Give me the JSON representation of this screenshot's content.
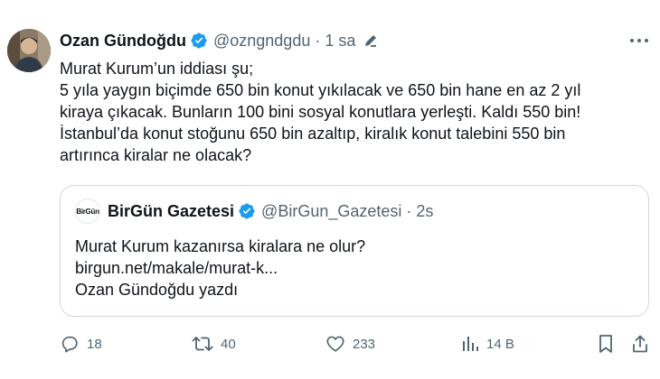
{
  "tweet": {
    "author_name": "Ozan Gündoğdu",
    "handle": "@ozngndgdu",
    "separator": "·",
    "time": "1 sa",
    "lines": [
      "Murat Kurum’un iddiası şu;",
      "5 yıla yaygın biçimde 650 bin konut yıkılacak ve 650 bin hane en az 2 yıl",
      "kiraya çıkacak. Bunların 100 bini sosyal konutlara yerleşti. Kaldı 550 bin!",
      "İstanbul’da konut stoğunu 650 bin azaltıp, kiralık konut talebini 550 bin",
      "artırınca kiralar ne olacak?"
    ]
  },
  "quote": {
    "avatar_text": "BirGün",
    "author_name": "BirGün Gazetesi",
    "handle": "@BirGun_Gazetesi",
    "separator": "·",
    "time": "2s",
    "lines": [
      "Murat Kurum kazanırsa kiralara ne olur?",
      "birgun.net/makale/murat-k...",
      "Ozan Gündoğdu yazdı"
    ]
  },
  "actions": {
    "replies": "18",
    "retweets": "40",
    "likes": "233",
    "views": "14 B"
  },
  "colors": {
    "verified": "#1d9bf0",
    "text": "#0f1419",
    "muted": "#536471",
    "border": "#cfd9de"
  },
  "icons": [
    "verified-badge-icon",
    "edit-pencil-icon",
    "more-icon",
    "reply-icon",
    "retweet-icon",
    "like-icon",
    "views-icon",
    "bookmark-icon",
    "share-icon"
  ]
}
